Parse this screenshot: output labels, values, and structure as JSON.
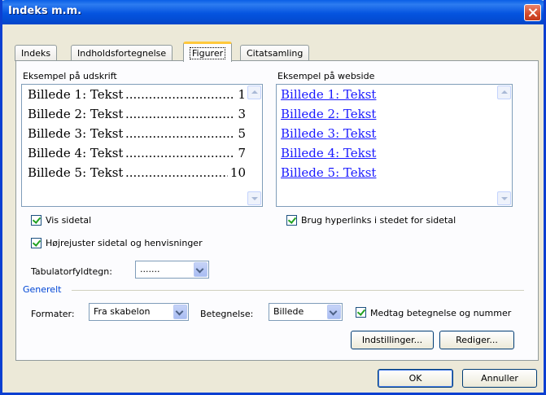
{
  "window": {
    "title": "Indeks m.m."
  },
  "tabs": [
    {
      "label": "Indeks"
    },
    {
      "label": "Indholdsfortegnelse"
    },
    {
      "label": "Figurer"
    },
    {
      "label": "Citatsamling"
    }
  ],
  "print_preview": {
    "label": "Eksempel på udskrift",
    "lines": [
      {
        "text": "Billede 1: Tekst",
        "page": "1"
      },
      {
        "text": "Billede 2: Tekst",
        "page": "3"
      },
      {
        "text": "Billede 3: Tekst",
        "page": "5"
      },
      {
        "text": "Billede 4: Tekst",
        "page": "7"
      },
      {
        "text": "Billede 5: Tekst",
        "page": "10"
      }
    ]
  },
  "web_preview": {
    "label": "Eksempel på webside",
    "lines": [
      "Billede 1: Tekst",
      "Billede 2: Tekst",
      "Billede 3: Tekst",
      "Billede 4: Tekst",
      "Billede 5: Tekst"
    ]
  },
  "options": {
    "show_page_numbers": "Vis sidetal",
    "right_align": "Højrejuster sidetal og henvisninger",
    "use_hyperlinks": "Brug hyperlinks i stedet for sidetal",
    "tab_leader_label": "Tabulatorfyldtegn:",
    "tab_leader_value": "......."
  },
  "general": {
    "title": "Generelt",
    "formats_label": "Formater:",
    "formats_value": "Fra skabelon",
    "caption_label": "Betegnelse:",
    "caption_value": "Billede",
    "include_label": "Medtag betegnelse og nummer",
    "settings_button": "Indstillinger...",
    "edit_button": "Rediger..."
  },
  "buttons": {
    "ok": "OK",
    "cancel": "Annuller"
  }
}
